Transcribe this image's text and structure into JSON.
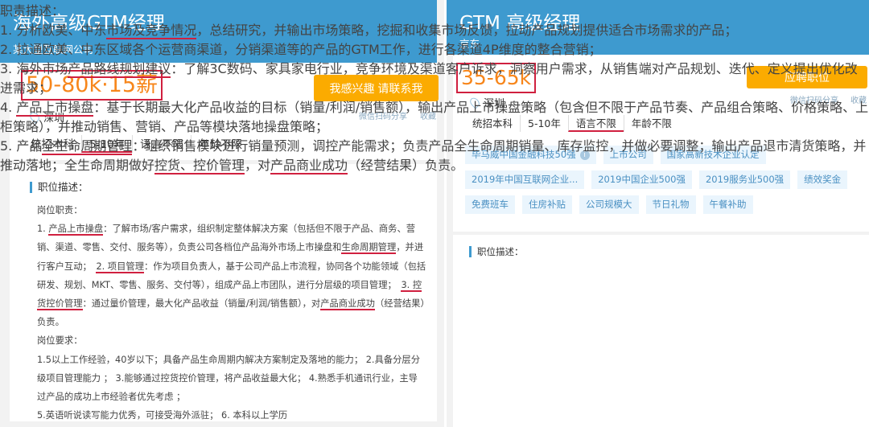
{
  "left": {
    "title": "海外高级GTM经理",
    "company": "某大型互联网公司",
    "salary": "50-80k·15薪",
    "button": "我感兴趣 请联系我",
    "location": "深圳",
    "share": "微信扫码分享",
    "favorite": "收藏",
    "requirements": [
      "统招本科",
      "5-10年",
      "语言不限",
      "年龄不限"
    ],
    "section_title": "职位描述：",
    "description": [
      [
        {
          "t": "岗位职责："
        }
      ],
      [
        {
          "t": "1. "
        },
        {
          "t": "产品上市操盘",
          "u": true
        },
        {
          "t": "：了解市场/客户需求，组织制定整体解决方案（包括但不限于产品、商务、营销、渠道、零售、交付、服务等），负责公司各档位产品海外市场上市操盘和"
        },
        {
          "t": "生命周期管理",
          "u": true
        },
        {
          "t": "，并进行客户互动；　"
        },
        {
          "t": "2. 项目管理",
          "u": true
        },
        {
          "t": "：作为项目负责人，基于公司产品上市流程，协同各个功能领域（包括研发、规划、MKT、零售、服务、交付等），组成产品上市团队，进行分层级的项目管理；　"
        },
        {
          "t": "3. 控货控价管理",
          "u": true
        },
        {
          "t": "：通过量价管理，最大化产品收益（销量/利润/销售额），对"
        },
        {
          "t": "产品商业成功",
          "u": true
        },
        {
          "t": "（经营结果）负责。"
        }
      ],
      [
        {
          "t": "岗位要求："
        }
      ],
      [
        {
          "t": "1.5以上工作经验，40岁以下；具备产品生命周期内解决方案制定及落地的能力； 2.具备分层分级项目管理能力 ； 3.能够通过控货控价管理，将产品收益最大化； 4.熟悉手机通讯行业，主导过产品的成功上市经验者优先考虑 ；"
        }
      ],
      [
        {
          "t": "5.英语听说读写能力优秀，可接受海外派驻； 6. 本科以上学历"
        }
      ]
    ]
  },
  "right": {
    "title": "GTM 高级经理",
    "company": "京东",
    "salary": "35-65k",
    "button": "应聘职位",
    "location": "深圳",
    "share": "微信扫码分享",
    "favorite": "收藏",
    "requirements": [
      "统招本科",
      "5-10年",
      "语言不限",
      "年龄不限"
    ],
    "tags": [
      "毕马威中国金融科技50强",
      "上市公司",
      "国家高新技术企业认定",
      "2019年中国互联网企业...",
      "2019中国企业500强",
      "2019服务业500强",
      "绩效奖金",
      "免费班车",
      "住房补贴",
      "公司规模大",
      "节日礼物",
      "午餐补助"
    ],
    "section_title": "职位描述：",
    "description": [
      [
        {
          "t": "职责描述："
        }
      ],
      [
        {
          "t": "1. 分析欧美、中东"
        },
        {
          "t": "市场及竞争情况",
          "u": true
        },
        {
          "t": "，总结研究，并输出市场策略，挖掘和收集市场反馈，拉动产品规划提供适合市场需求的产品；"
        }
      ],
      [
        {
          "t": "2. 拉通欧美、中东区域各个运营商渠道，分销渠道等的产品的GTM工作，进行各渠道4P维度的整合营销；"
        }
      ],
      [
        {
          "t": "3. 海外市场"
        },
        {
          "t": "产品路线规划建议",
          "u": true
        },
        {
          "t": "：了解3C数码、家具家电行业，竞争环境及渠道客户诉求，洞察用户需求，从销售端对产品规划、迭代、定义提出优化改进需求；"
        }
      ],
      [
        {
          "t": "4. "
        },
        {
          "t": "产品上市操盘",
          "u": true
        },
        {
          "t": "：基于长期最大化产品收益的目标（销量/利润/销售额），输出产品上市操盘策略（包含但不限于产品节奏、产品组合策略、价格策略、上柜策略），并推动销售、营销、产品等模块落地操盘策略；"
        }
      ],
      [
        {
          "t": "5. 产品"
        },
        {
          "t": "全生命周期管理",
          "u": true
        },
        {
          "t": "：组织销售模块进行销量预测，调控产能需求；负责产品全生命周期销量、库存监控，并做必要调整；输出产品退市清货策略，并推动落地；全生命周期做好"
        },
        {
          "t": "控货、控价管理",
          "u": true
        },
        {
          "t": "，对"
        },
        {
          "t": "产品商业成功",
          "u": true
        },
        {
          "t": "（经营结果）负责。"
        }
      ]
    ]
  },
  "colors": {
    "header": "#3e9acf",
    "salary": "#f7861b",
    "button": "#fbab00",
    "highlight": "#d0203f"
  }
}
